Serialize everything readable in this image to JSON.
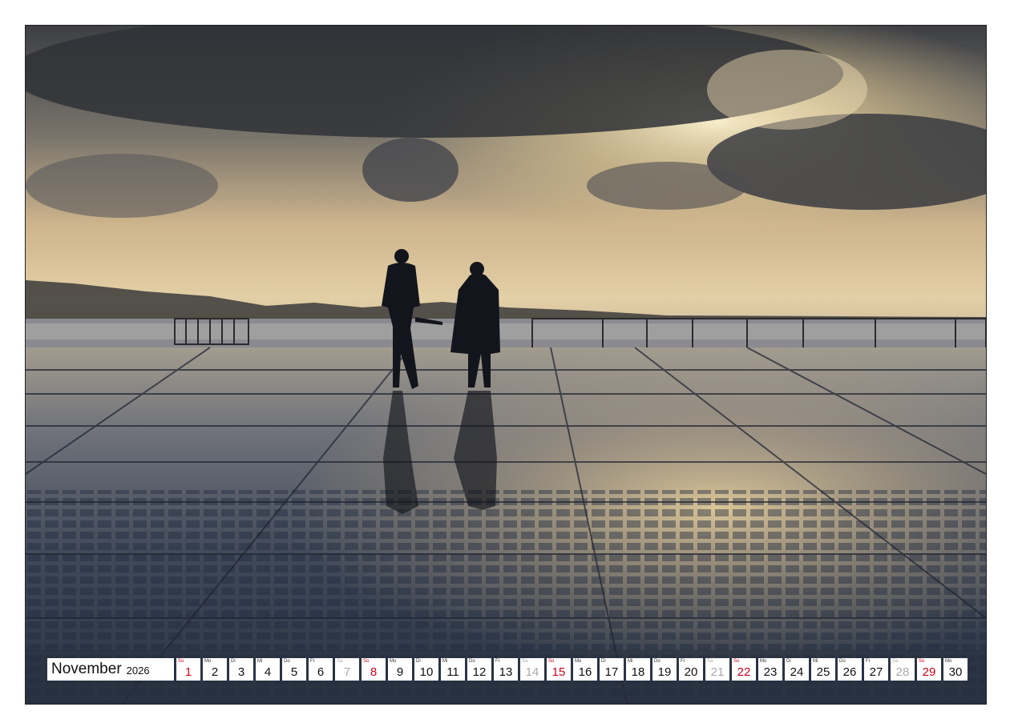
{
  "calendar": {
    "month": "November",
    "year": "2026",
    "days": [
      {
        "wd": "So",
        "num": "1",
        "type": "sun"
      },
      {
        "wd": "Mo",
        "num": "2",
        "type": "wk"
      },
      {
        "wd": "Di",
        "num": "3",
        "type": "wk"
      },
      {
        "wd": "Mi",
        "num": "4",
        "type": "wk"
      },
      {
        "wd": "Do",
        "num": "5",
        "type": "wk"
      },
      {
        "wd": "Fr",
        "num": "6",
        "type": "wk"
      },
      {
        "wd": "Sa",
        "num": "7",
        "type": "sat"
      },
      {
        "wd": "So",
        "num": "8",
        "type": "sun"
      },
      {
        "wd": "Mo",
        "num": "9",
        "type": "wk"
      },
      {
        "wd": "Di",
        "num": "10",
        "type": "wk"
      },
      {
        "wd": "Mi",
        "num": "11",
        "type": "wk"
      },
      {
        "wd": "Do",
        "num": "12",
        "type": "wk"
      },
      {
        "wd": "Fr",
        "num": "13",
        "type": "wk"
      },
      {
        "wd": "Sa",
        "num": "14",
        "type": "sat"
      },
      {
        "wd": "So",
        "num": "15",
        "type": "sun"
      },
      {
        "wd": "Mo",
        "num": "16",
        "type": "wk"
      },
      {
        "wd": "Di",
        "num": "17",
        "type": "wk"
      },
      {
        "wd": "Mi",
        "num": "18",
        "type": "wk"
      },
      {
        "wd": "Do",
        "num": "19",
        "type": "wk"
      },
      {
        "wd": "Fr",
        "num": "20",
        "type": "wk"
      },
      {
        "wd": "Sa",
        "num": "21",
        "type": "sat"
      },
      {
        "wd": "So",
        "num": "22",
        "type": "sun"
      },
      {
        "wd": "Mo",
        "num": "23",
        "type": "wk"
      },
      {
        "wd": "Di",
        "num": "24",
        "type": "wk"
      },
      {
        "wd": "Mi",
        "num": "25",
        "type": "wk"
      },
      {
        "wd": "Do",
        "num": "26",
        "type": "wk"
      },
      {
        "wd": "Fr",
        "num": "27",
        "type": "wk"
      },
      {
        "wd": "Sa",
        "num": "28",
        "type": "sat"
      },
      {
        "wd": "So",
        "num": "29",
        "type": "sun"
      },
      {
        "wd": "Mo",
        "num": "30",
        "type": "wk"
      }
    ]
  },
  "colors": {
    "sunday": "#d0021b",
    "saturday": "#aaaaaa",
    "weekday": "#111111"
  }
}
